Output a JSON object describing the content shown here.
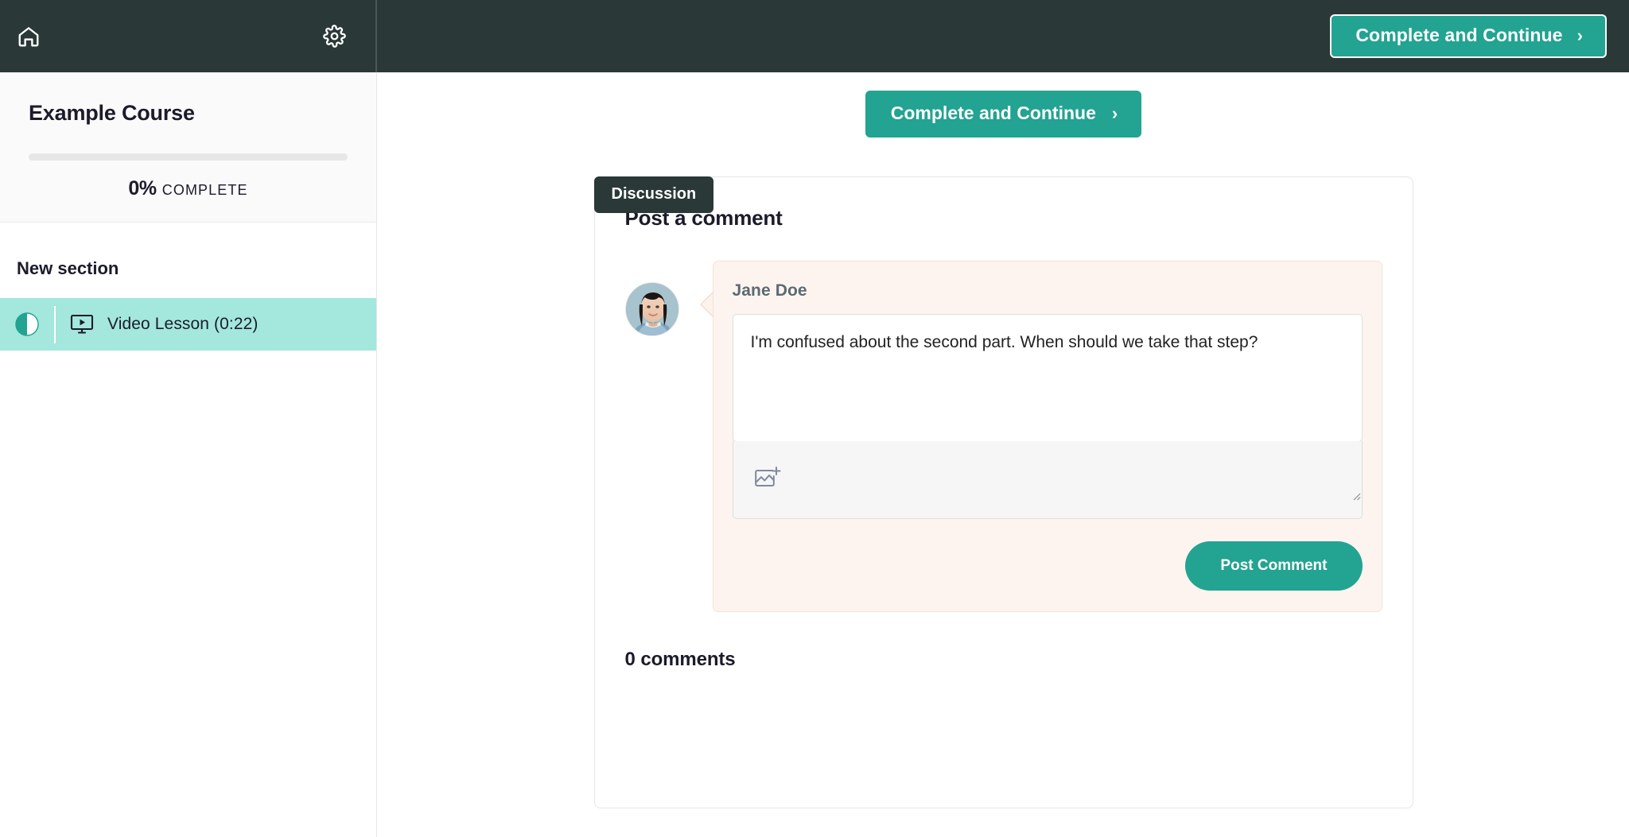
{
  "topbar": {
    "home_icon": "home-icon",
    "settings_icon": "gear-icon",
    "cta_label": "Complete and Continue",
    "cta_chevron": "›"
  },
  "sidebar": {
    "course_title": "Example Course",
    "progress_percent": "0%",
    "progress_word": "COMPLETE",
    "progress_value": 0,
    "section_title": "New section",
    "lessons": [
      {
        "label": "Video Lesson (0:22)",
        "type_icon": "video-monitor-icon",
        "status_icon": "half-circle-progress-icon",
        "selected": true
      }
    ]
  },
  "main": {
    "cta_label": "Complete and Continue",
    "cta_chevron": "›",
    "tab_label": "Discussion",
    "card_heading": "Post a comment",
    "composer": {
      "avatar_alt": "avatar",
      "author_name": "Jane Doe",
      "comment_value": "I'm confused about the second part. When should we take that step?",
      "comment_placeholder": "Write a comment...",
      "upload_icon": "add-image-icon",
      "post_label": "Post Comment"
    },
    "comments_count_label": "0 comments"
  },
  "colors": {
    "accent_teal": "#23a391",
    "dark_bar": "#2a3837",
    "lesson_highlight": "#a3e7dd",
    "bubble_bg": "#fdf4ef",
    "bubble_border": "#f4e2d7"
  }
}
